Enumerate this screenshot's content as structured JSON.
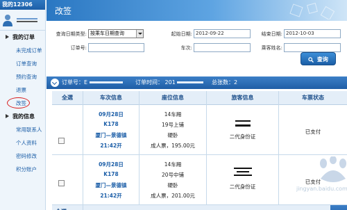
{
  "sidebar": {
    "header": "我的12306",
    "sections": [
      {
        "label": "我的订单",
        "items": [
          "未完成订单",
          "订单查询",
          "预约查询",
          "退票",
          "改签"
        ]
      },
      {
        "label": "我的信息",
        "items": [
          "常用联系人",
          "个人资料",
          "密码修改",
          "积分账户"
        ]
      }
    ],
    "active_item": "改签"
  },
  "page": {
    "title": "改签"
  },
  "search": {
    "date_type_label": "查询日期类型:",
    "date_type_value": "按乘车日期查询",
    "start_date_label": "起始日期:",
    "start_date_value": "2012-09-22",
    "end_date_label": "结束日期:",
    "end_date_value": "2012-10-03",
    "order_no_label": "订单号:",
    "order_no_value": "",
    "train_no_label": "车次:",
    "train_no_value": "",
    "passenger_label": "乘客姓名:",
    "passenger_value": "",
    "query_button": "查询"
  },
  "order_bar": {
    "order_no_label": "订单号：E",
    "order_time_label": "订单时间： 201",
    "total_label": "总张数：2"
  },
  "table": {
    "headers": [
      "全選",
      "车次信息",
      "座位信息",
      "旅客信息",
      "车票状态"
    ],
    "rows": [
      {
        "date": "09月28日",
        "train": "K178",
        "route": "厦门—景德镇",
        "time": "21:42开",
        "car": "14车厢",
        "seat": "19号上铺",
        "berth": "硬卧",
        "price": "成人票，195.00元",
        "id_type": "二代身份证",
        "status": "已支付"
      },
      {
        "date": "09月28日",
        "train": "K178",
        "route": "厦门—景德镇",
        "time": "21:42开",
        "car": "14车厢",
        "seat": "20号中铺",
        "berth": "硬卧",
        "price": "成人票，201.00元",
        "id_type": "二代身份证",
        "status": "已支付"
      }
    ],
    "footer_select_all": "全選"
  },
  "watermark": {
    "text": "jingyan.baidu.com"
  }
}
